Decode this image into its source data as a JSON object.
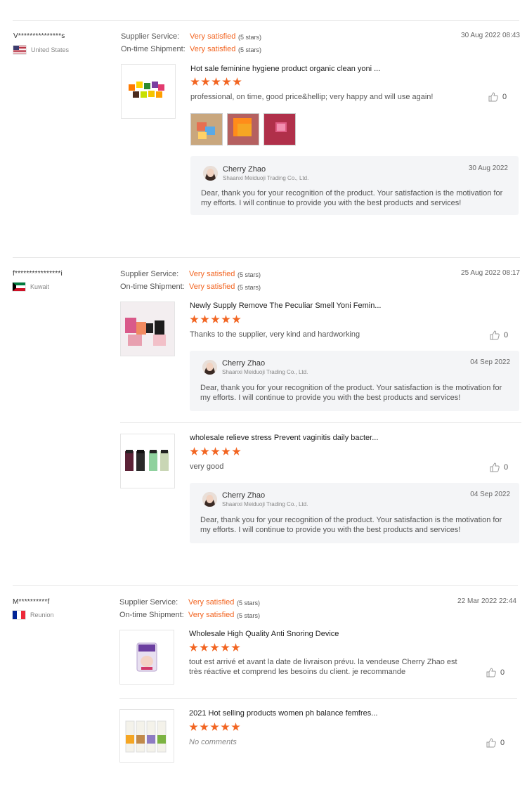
{
  "labels": {
    "supplier_service": "Supplier Service:",
    "ontime_shipment": "On-time Shipment:"
  },
  "reviews": [
    {
      "buyer": "V***************s",
      "country": "United States",
      "date": "30 Aug 2022 08:43",
      "supplier_rating": "Very satisfied",
      "supplier_stars": "(5 stars)",
      "shipment_rating": "Very satisfied",
      "shipment_stars": "(5 stars)",
      "products": [
        {
          "title": "Hot sale feminine hygiene product organic clean yoni ...",
          "rating": 5,
          "comment": "professional, on time, good price&hellip; very happy and will use again!",
          "likes": "0",
          "reply": {
            "name": "Cherry Zhao",
            "company": "Shaanxi Meiduoji Trading Co., Ltd.",
            "date": "30 Aug 2022",
            "text": "Dear, thank you for your recognition of the product. Your satisfaction is the motivation for my efforts. I will continue to provide you with the best products and services!"
          }
        }
      ]
    },
    {
      "buyer": "f****************i",
      "country": "Kuwait",
      "date": "25 Aug 2022 08:17",
      "supplier_rating": "Very satisfied",
      "supplier_stars": "(5 stars)",
      "shipment_rating": "Very satisfied",
      "shipment_stars": "(5 stars)",
      "products": [
        {
          "title": "Newly Supply Remove The Peculiar Smell Yoni Femin...",
          "rating": 5,
          "comment": "Thanks to the supplier, very kind and hardworking",
          "likes": "0",
          "reply": {
            "name": "Cherry Zhao",
            "company": "Shaanxi Meiduoji Trading Co., Ltd.",
            "date": "04 Sep 2022",
            "text": "Dear, thank you for your recognition of the product. Your satisfaction is the motivation for my efforts. I will continue to provide you with the best products and services!"
          }
        },
        {
          "title": "wholesale relieve stress Prevent vaginitis daily bacter...",
          "rating": 5,
          "comment": "very good",
          "likes": "0",
          "reply": {
            "name": "Cherry Zhao",
            "company": "Shaanxi Meiduoji Trading Co., Ltd.",
            "date": "04 Sep 2022",
            "text": "Dear, thank you for your recognition of the product. Your satisfaction is the motivation for my efforts. I will continue to provide you with the best products and services!"
          }
        }
      ]
    },
    {
      "buyer": "M**********f",
      "country": "Reunion",
      "date": "22 Mar 2022 22:44",
      "supplier_rating": "Very satisfied",
      "supplier_stars": "(5 stars)",
      "shipment_rating": "Very satisfied",
      "shipment_stars": "(5 stars)",
      "products": [
        {
          "title": "Wholesale High Quality Anti Snoring Device",
          "rating": 5,
          "comment": "tout est arrivé et avant la date de livraison prévu. la vendeuse Cherry Zhao est très réactive et comprend les besoins du client. je recommande",
          "likes": "0"
        },
        {
          "title": "2021 Hot selling products women ph balance femfres...",
          "rating": 5,
          "comment": "No comments",
          "likes": "0"
        }
      ]
    }
  ],
  "colors": {
    "accent": "#f26522",
    "reply_bg": "#f4f5f7"
  },
  "icons": {
    "like": "thumbs-up-icon"
  }
}
